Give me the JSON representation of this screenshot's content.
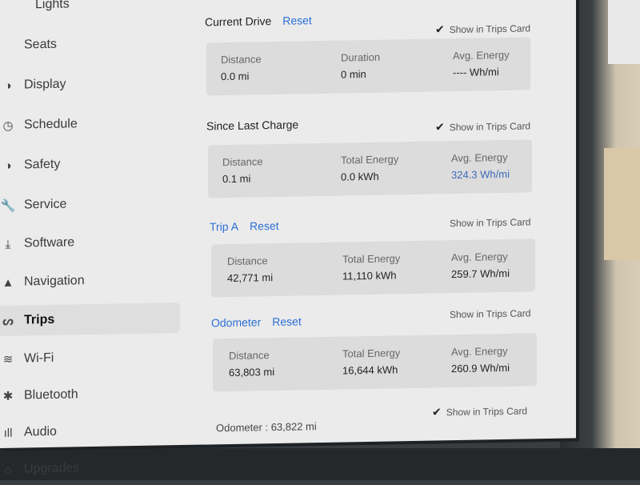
{
  "sidebar": {
    "items": [
      {
        "label": "Lights",
        "icon": "lights-icon",
        "glyph": ""
      },
      {
        "label": "Seats",
        "icon": "seat-icon",
        "glyph": ""
      },
      {
        "label": "Display",
        "icon": "display-icon",
        "glyph": "◑"
      },
      {
        "label": "Schedule",
        "icon": "schedule-icon",
        "glyph": "◷"
      },
      {
        "label": "Safety",
        "icon": "safety-icon",
        "glyph": "◑"
      },
      {
        "label": "Service",
        "icon": "wrench-icon",
        "glyph": "🔧"
      },
      {
        "label": "Software",
        "icon": "download-icon",
        "glyph": "⤓"
      },
      {
        "label": "Navigation",
        "icon": "navigation-icon",
        "glyph": "▲"
      },
      {
        "label": "Trips",
        "icon": "trips-icon",
        "glyph": "ᔕ"
      },
      {
        "label": "Wi-Fi",
        "icon": "wifi-icon",
        "glyph": "≋"
      },
      {
        "label": "Bluetooth",
        "icon": "bluetooth-icon",
        "glyph": "✱"
      },
      {
        "label": "Audio",
        "icon": "audio-icon",
        "glyph": "ıll"
      },
      {
        "label": "Upgrades",
        "icon": "upgrades-icon",
        "glyph": "⌂"
      }
    ],
    "active": "Trips"
  },
  "current_drive": {
    "title": "Current Drive",
    "reset": "Reset",
    "show_in_trips_card": "Show in Trips Card",
    "checked": true,
    "metrics": [
      {
        "label": "Distance",
        "value": "0.0 mi"
      },
      {
        "label": "Duration",
        "value": "0 min"
      },
      {
        "label": "Avg. Energy",
        "value": "---- Wh/mi"
      }
    ]
  },
  "since_last_charge": {
    "title": "Since Last Charge",
    "show_in_trips_card": "Show in Trips Card",
    "checked": true,
    "metrics": [
      {
        "label": "Distance",
        "value": "0.1 mi"
      },
      {
        "label": "Total Energy",
        "value": "0.0 kWh"
      },
      {
        "label": "Avg. Energy",
        "value": "324.3 Wh/mi"
      }
    ]
  },
  "trip_a": {
    "title": "Trip A",
    "reset": "Reset",
    "show_in_trips_card": "Show in Trips Card",
    "checked": false,
    "metrics": [
      {
        "label": "Distance",
        "value": "42,771 mi"
      },
      {
        "label": "Total Energy",
        "value": "11,110 kWh"
      },
      {
        "label": "Avg. Energy",
        "value": "259.7 Wh/mi"
      }
    ]
  },
  "odometer_section": {
    "title": "Odometer",
    "reset": "Reset",
    "show_in_trips_card": "Show in Trips Card",
    "checked": false,
    "metrics": [
      {
        "label": "Distance",
        "value": "63,803 mi"
      },
      {
        "label": "Total Energy",
        "value": "16,644 kWh"
      },
      {
        "label": "Avg. Energy",
        "value": "260.9 Wh/mi"
      }
    ]
  },
  "footer": {
    "odometer_label": "Odometer",
    "odometer_sep": ":",
    "odometer_value": "63,822 mi",
    "show_in_trips_card": "Show in Trips Card",
    "checked": true
  }
}
